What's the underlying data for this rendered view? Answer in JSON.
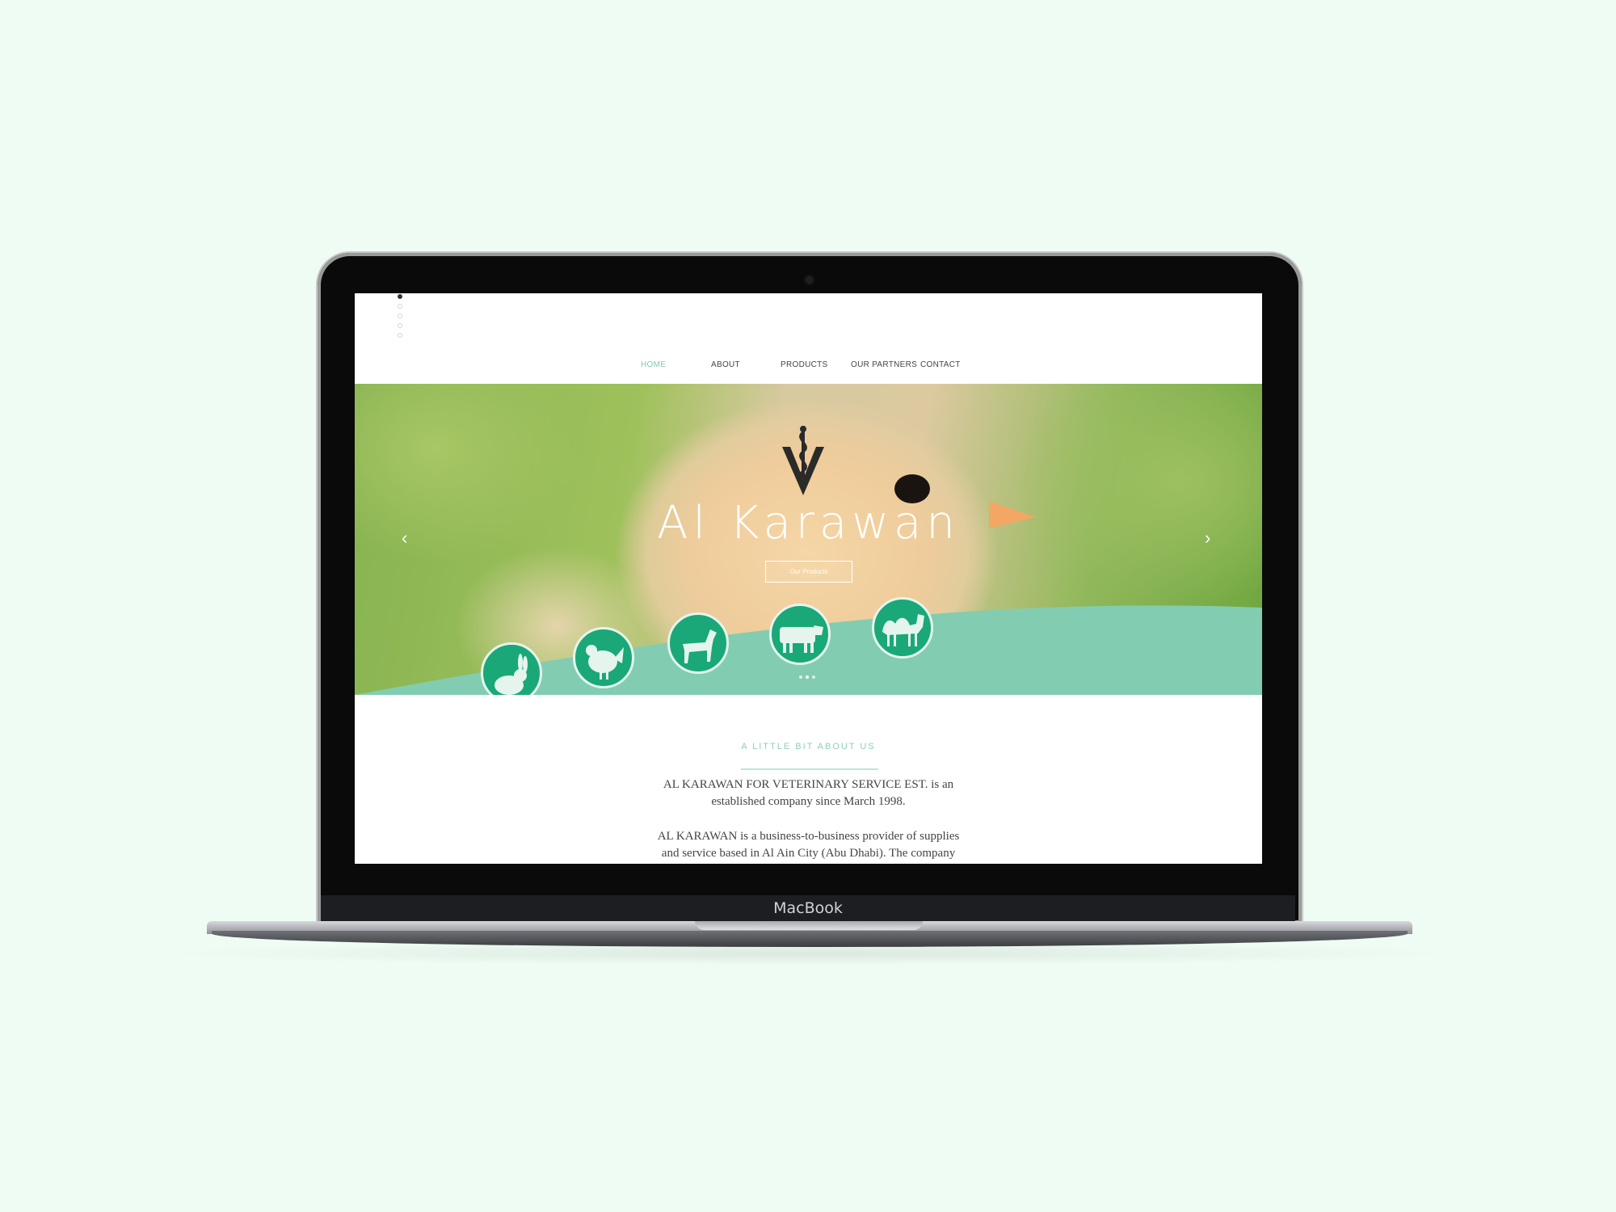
{
  "device": {
    "brand": "MacBook"
  },
  "nav": {
    "items": [
      {
        "label": "HOME",
        "active": true
      },
      {
        "label": "ABOUT"
      },
      {
        "label": "PRODUCTS"
      },
      {
        "label": "OUR PARTNERS"
      },
      {
        "label": "CONTACT"
      }
    ]
  },
  "page_dots": {
    "count": 5,
    "active": 0
  },
  "hero": {
    "title": "Al Karawan",
    "button_label": "Our Products",
    "slide_dots": {
      "count": 3,
      "active": 1
    },
    "animal_icons": [
      "rabbit-icon",
      "chicken-icon",
      "horse-icon",
      "cow-icon",
      "camel-icon"
    ]
  },
  "about": {
    "heading": "A LITTLE BIT ABOUT US",
    "paragraphs": [
      "AL KARAWAN FOR VETERINARY SERVICE EST. is an",
      "established company since March 1998.",
      "AL KARAWAN is a business-to-business provider of supplies",
      "and service based in Al Ain City (Abu Dhabi). The company"
    ]
  },
  "colors": {
    "accent": "#82cdb2",
    "icon_green": "#1aa878",
    "background": "#eefcf3"
  }
}
